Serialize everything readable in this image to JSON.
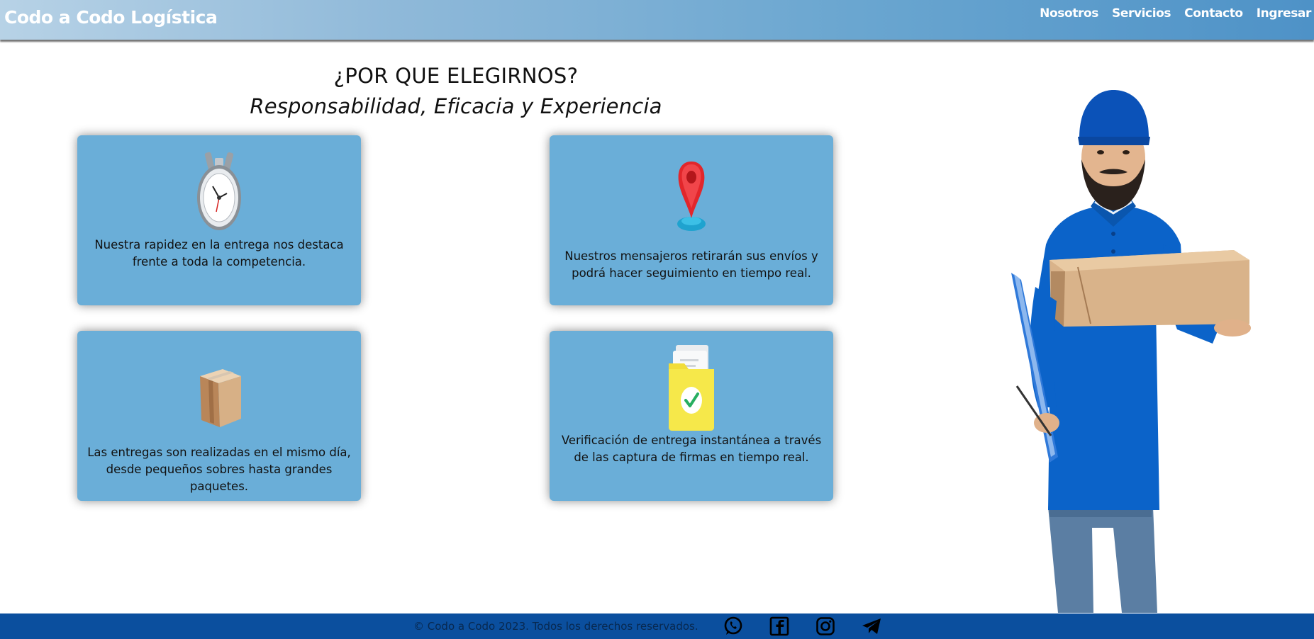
{
  "header": {
    "brand": "Codo a Codo Logística",
    "nav": [
      "Nosotros",
      "Servicios",
      "Contacto",
      "Ingresar"
    ]
  },
  "section": {
    "title": "¿POR QUE ELEGIRNOS?",
    "subtitle": "Responsabilidad, Eficacia y Experiencia"
  },
  "cards": [
    {
      "icon": "stopwatch-icon",
      "text": "Nuestra rapidez en la entrega nos destaca frente a toda la competencia."
    },
    {
      "icon": "location-pin-icon",
      "text": "Nuestros mensajeros retirarán sus envíos y podrá hacer seguimiento en tiempo real."
    },
    {
      "icon": "package-box-icon",
      "text": "Las entregas son realizadas en el mismo día, desde pequeños sobres hasta grandes paquetes."
    },
    {
      "icon": "verified-folder-icon",
      "text": "Verificación de entrega instantánea a través de las captura de firmas en tiempo real."
    }
  ],
  "footer": {
    "copyright": "© Codo a Codo 2023. Todos los derechos reservados.",
    "social": [
      "whatsapp-icon",
      "facebook-icon",
      "instagram-icon",
      "telegram-icon"
    ]
  },
  "colors": {
    "header_gradient_start": "#b7d2e6",
    "header_gradient_end": "#4e92c7",
    "card_background": "#6aaed8",
    "footer_background": "#0b4f9e"
  }
}
